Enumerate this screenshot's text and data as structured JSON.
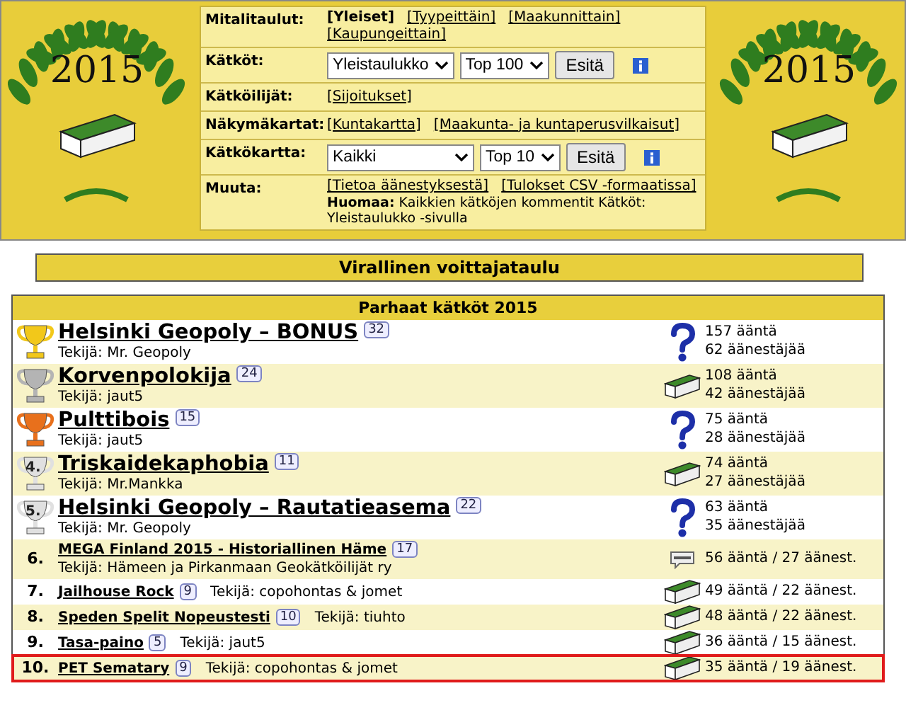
{
  "emblems": [
    {
      "year": "2015"
    },
    {
      "year": "2015"
    }
  ],
  "nav": [
    {
      "label": "Mitalitaulut:",
      "items": [
        {
          "kind": "link",
          "text": "[Yleiset]",
          "selected": true
        },
        {
          "kind": "link",
          "text": "[Tyypeittäin]",
          "selected": false
        },
        {
          "kind": "link",
          "text": "[Maakunnittain]",
          "selected": false
        },
        {
          "kind": "link",
          "text": "[Kaupungeittain]",
          "selected": false
        }
      ]
    },
    {
      "label": "Kätköt:",
      "items": [
        {
          "kind": "select",
          "value": "Yleistaulukko"
        },
        {
          "kind": "select",
          "value": "Top 100"
        },
        {
          "kind": "button",
          "text": "Esitä"
        },
        {
          "kind": "info"
        }
      ]
    },
    {
      "label": "Kätköilijät:",
      "items": [
        {
          "kind": "link",
          "text": "[Sijoitukset]",
          "selected": false
        }
      ]
    },
    {
      "label": "Näkymäkartat:",
      "items": [
        {
          "kind": "link",
          "text": "[Kuntakartta]",
          "selected": false
        },
        {
          "kind": "link",
          "text": "[Maakunta- ja kuntaperusvilkaisut]",
          "selected": false
        }
      ]
    },
    {
      "label": "Kätkökartta:",
      "items": [
        {
          "kind": "wideselect",
          "value": "Kaikki"
        },
        {
          "kind": "select",
          "value": "Top 10"
        },
        {
          "kind": "button",
          "text": "Esitä"
        },
        {
          "kind": "info"
        }
      ]
    },
    {
      "label": "Muuta:",
      "items": [
        {
          "kind": "link",
          "text": "[Tietoa äänestyksestä]",
          "selected": false
        },
        {
          "kind": "link",
          "text": "[Tulokset CSV -formaatissa]",
          "selected": false
        },
        {
          "kind": "note",
          "text": "**Huomaa:** Kaikkien kätköjen kommentit Kätköt: Yleistaulukko -sivulla"
        }
      ]
    }
  ],
  "title": "Virallinen voittajataulu",
  "table": {
    "heading": "Parhaat kätköt 2015",
    "rows": [
      {
        "kind": "top",
        "color": "#f2c81a",
        "name": "Helsinki Geopoly – BONUS",
        "comments": "32",
        "author": "Tekijä: Mr. Geopoly",
        "cache": {
          "kind": "mystery"
        },
        "votes": [
          "157 ääntä",
          "62 äänestäjää"
        ],
        "highlighted": false
      },
      {
        "kind": "top",
        "color": "#b4b4b4",
        "name": "Korvenpolokija",
        "comments": "24",
        "author": "Tekijä: jaut5",
        "cache": {
          "kind": "traditional"
        },
        "votes": [
          "108 ääntä",
          "42 äänestäjää"
        ],
        "highlighted": false
      },
      {
        "kind": "top",
        "color": "#e8701c",
        "name": "Pulttibois",
        "comments": "15",
        "author": "Tekijä: jaut5",
        "cache": {
          "kind": "mystery"
        },
        "votes": [
          "75 ääntä",
          "28 äänestäjää"
        ],
        "highlighted": false
      },
      {
        "kind": "top",
        "color": "#e0e0e0",
        "rank": "4.",
        "name": "Triskaidekaphobia",
        "comments": "11",
        "author": "Tekijä: Mr.Mankka",
        "cache": {
          "kind": "traditional"
        },
        "votes": [
          "74 ääntä",
          "27 äänestäjää"
        ],
        "highlighted": false
      },
      {
        "kind": "top",
        "color": "#e0e0e0",
        "rank": "5.",
        "name": "Helsinki Geopoly – Rautatieasema",
        "comments": "22",
        "author": "Tekijä: Mr. Geopoly",
        "cache": {
          "kind": "mystery"
        },
        "votes": [
          "63 ääntä",
          "35 äänestäjää"
        ],
        "highlighted": false
      },
      {
        "kind": "list",
        "rank": "6.",
        "name": "MEGA Finland 2015 - Historiallinen Häme",
        "comments": "17",
        "author": "Tekijä: Hämeen ja Pirkanmaan Geokätköilijät ry",
        "cache": {
          "kind": "mega"
        },
        "votes": [
          "56 ääntä / 27 äänest."
        ],
        "highlighted": false
      },
      {
        "kind": "list",
        "rank": "7.",
        "name": "Jailhouse Rock",
        "comments": "9",
        "author": "Tekijä: copohontas & jomet",
        "cache": {
          "kind": "traditional"
        },
        "votes": [
          "49 ääntä / 22 äänest."
        ],
        "highlighted": false
      },
      {
        "kind": "list",
        "rank": "8.",
        "name": "Speden Spelit Nopeustesti",
        "comments": "10",
        "author": "Tekijä: tiuhto",
        "cache": {
          "kind": "traditional"
        },
        "votes": [
          "48 ääntä / 22 äänest."
        ],
        "highlighted": false
      },
      {
        "kind": "list",
        "rank": "9.",
        "name": "Tasa-paino",
        "comments": "5",
        "author": "Tekijä: jaut5",
        "cache": {
          "kind": "traditional"
        },
        "votes": [
          "36 ääntä / 15 äänest."
        ],
        "highlighted": false
      },
      {
        "kind": "list",
        "rank": "10.",
        "name": "PET Sematary",
        "comments": "9",
        "author": "Tekijä: copohontas & jomet",
        "cache": {
          "kind": "traditional"
        },
        "votes": [
          "35 ääntä / 19 äänest."
        ],
        "highlighted": true
      }
    ]
  }
}
